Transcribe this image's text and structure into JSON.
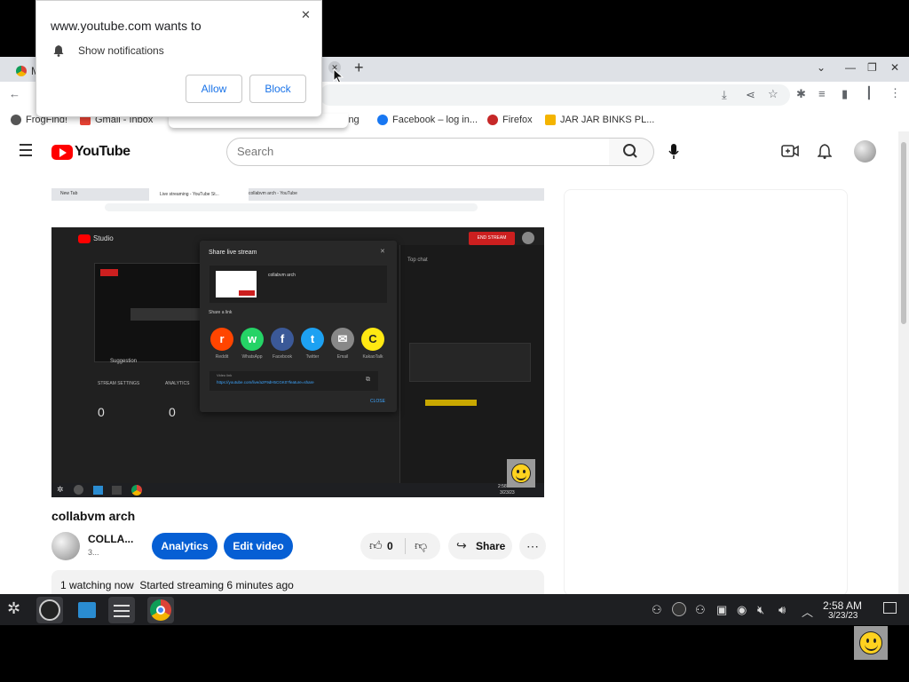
{
  "popup": {
    "title": "www.youtube.com wants to",
    "permission": "Show notifications",
    "allow_label": "Allow",
    "block_label": "Block",
    "close_glyph": "✕"
  },
  "browser": {
    "tab_partial": "M",
    "new_tab_glyph": "+",
    "tab_close_glyph": "✕",
    "window_controls": [
      "⌄",
      "—",
      "❐",
      "✕"
    ],
    "bookmarks": [
      {
        "label": "FrogFind!",
        "color": "#555"
      },
      {
        "label": "Gmail - Inbox",
        "color": "#ea4335"
      },
      {
        "label": "ing",
        "color": "#888"
      },
      {
        "label": "Facebook – log in...",
        "color": "#1877f2"
      },
      {
        "label": "Firefox",
        "color": "#c62828"
      },
      {
        "label": "JAR JAR BINKS PL...",
        "color": "#f4b400"
      }
    ]
  },
  "youtube": {
    "logo_text": "YouTube",
    "search_placeholder": "Search",
    "video_title": "collabvm arch",
    "channel_name": "COLLA...",
    "channel_subs": "3...",
    "analytics_label": "Analytics",
    "edit_video_label": "Edit video",
    "like_count": "0",
    "share_label": "Share",
    "more_glyph": "⋯",
    "watching_text": "1 watching now  Started streaming 6 minutes ago",
    "accent": "#065fd4",
    "logo_red": "#ff0000"
  },
  "embedded": {
    "tabs": [
      "New Tab",
      "Live streaming - YouTube St...",
      "collabvm arch - YouTube"
    ],
    "studio_label": "Studio",
    "end_stream_label": "END STREAM",
    "top_chat_label": "Top chat",
    "share_title": "Share live stream",
    "share_video_name": "collabvm arch",
    "share_a_link": "Share a link",
    "share_targets": [
      {
        "label": "Reddit",
        "color": "#ff4500",
        "glyph": "r"
      },
      {
        "label": "WhatsApp",
        "color": "#25d366",
        "glyph": "w"
      },
      {
        "label": "Facebook",
        "color": "#3b5998",
        "glyph": "f"
      },
      {
        "label": "Twitter",
        "color": "#1da1f2",
        "glyph": "t"
      },
      {
        "label": "Email",
        "color": "#888888",
        "glyph": "✉"
      },
      {
        "label": "KakaoTalk",
        "color": "#ffe812",
        "glyph": "C"
      }
    ],
    "video_link_label": "Video link",
    "video_link": "https://youtube.com/live/a2F9dH5CGK0?feature=share",
    "close_label": "CLOSE",
    "suggestion_label": "Suggestion",
    "stream_settings_label": "STREAM SETTINGS",
    "analytics_tab_label": "ANALYTICS",
    "stat_zero_a": "0",
    "stat_zero_b": "0",
    "clock_time": "2:58 AM",
    "clock_date": "3/23/23"
  },
  "taskbar": {
    "time": "2:58 AM",
    "date": "3/23/23"
  }
}
